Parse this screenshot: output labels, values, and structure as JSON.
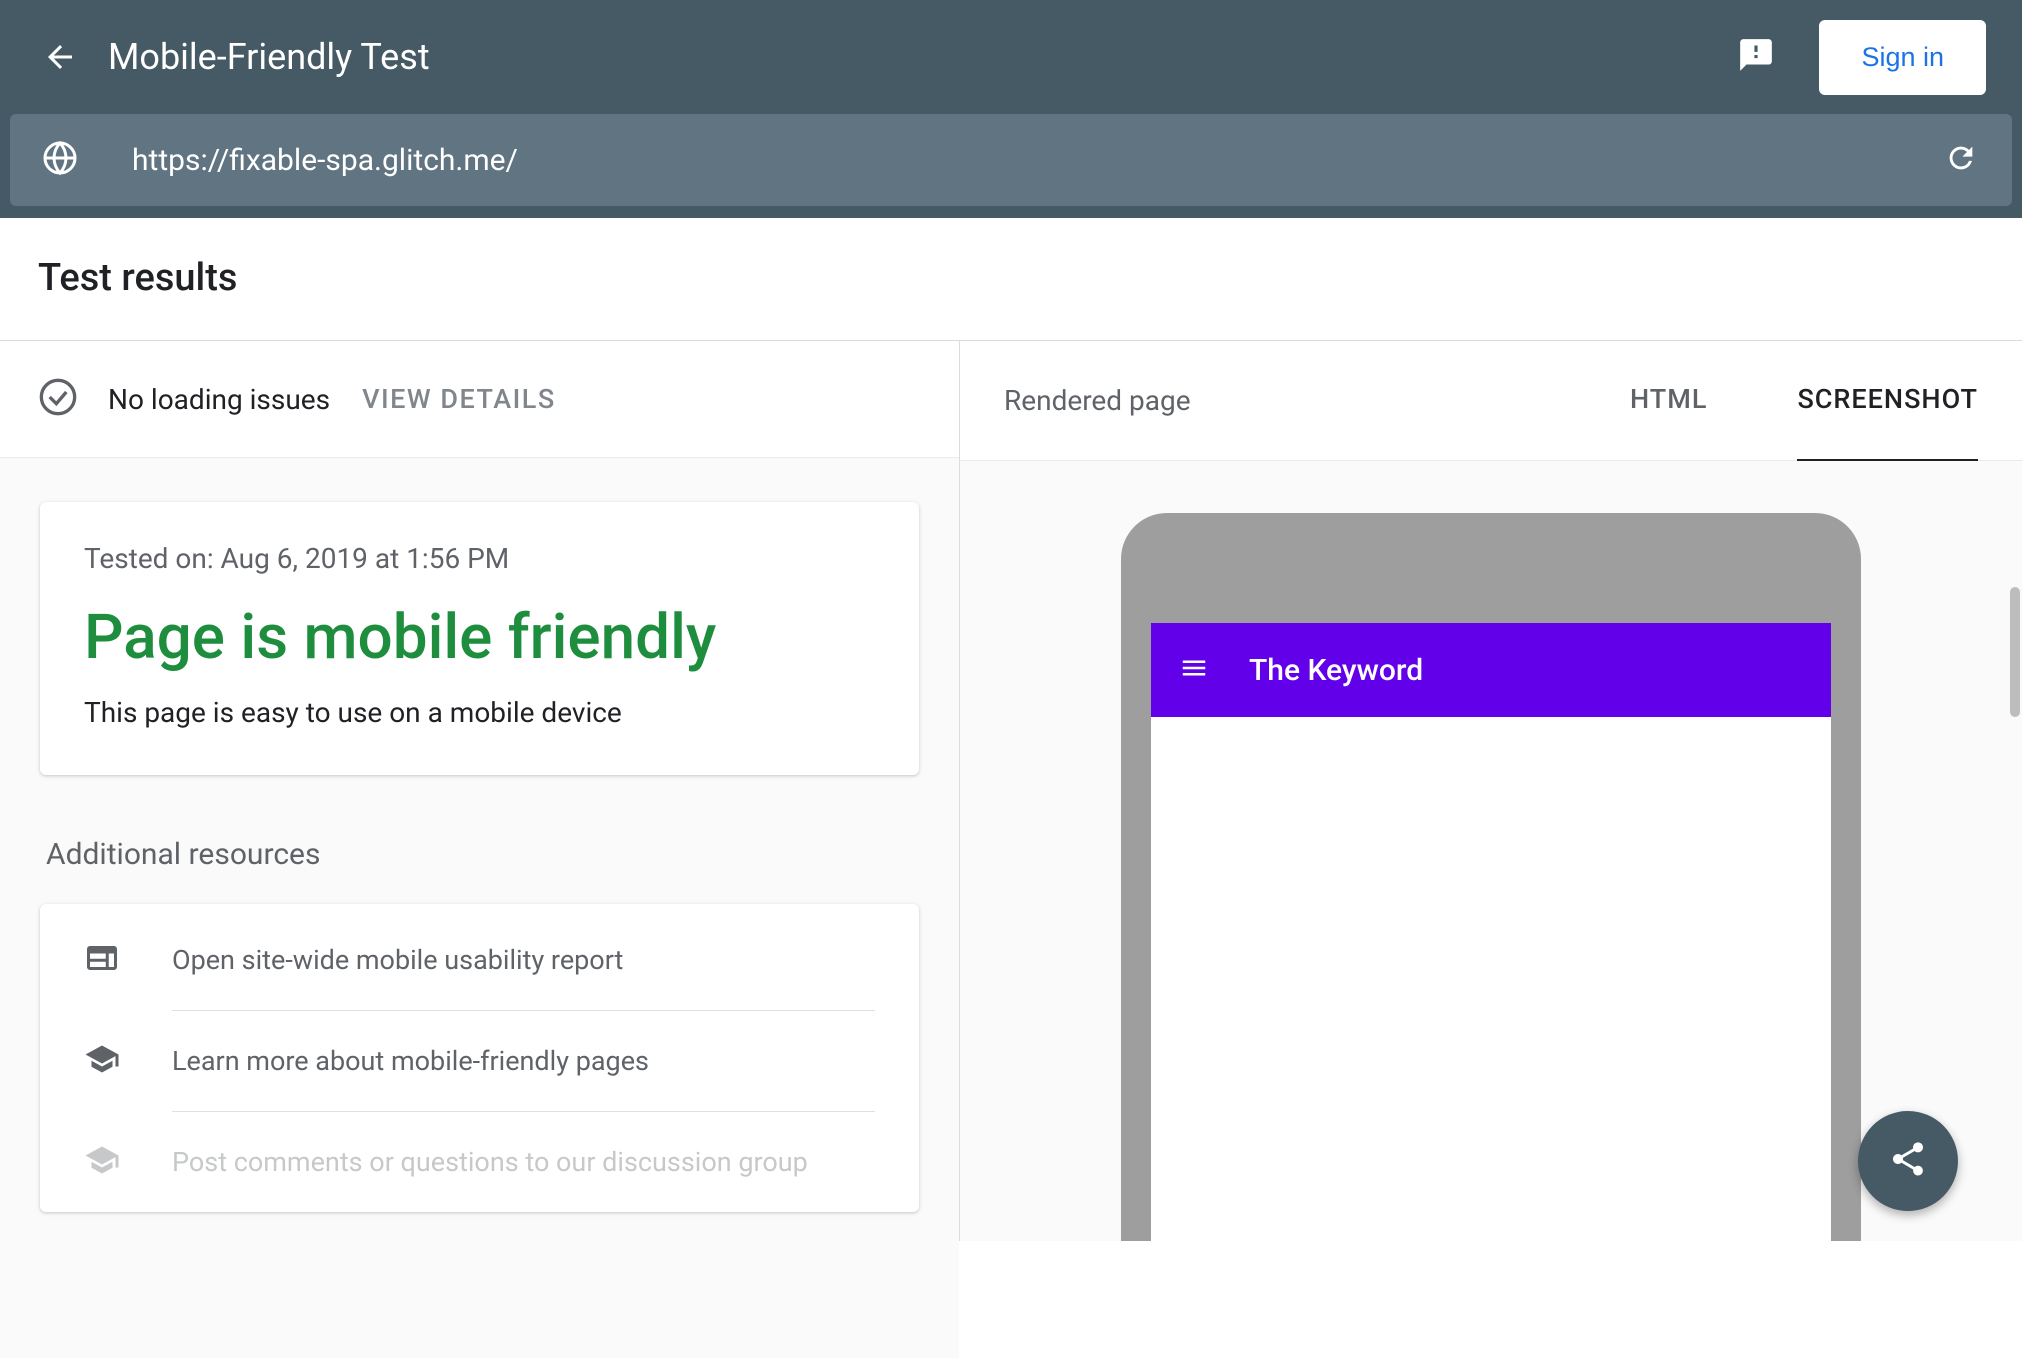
{
  "header": {
    "title": "Mobile-Friendly Test",
    "signin_label": "Sign in"
  },
  "urlbar": {
    "url": "https://fixable-spa.glitch.me/"
  },
  "results": {
    "heading": "Test results",
    "loading_status": "No loading issues",
    "view_details": "VIEW DETAILS",
    "tested_on": "Tested on: Aug 6, 2019 at 1:56 PM",
    "verdict": "Page is mobile friendly",
    "verdict_desc": "This page is easy to use on a mobile device"
  },
  "resources": {
    "title": "Additional resources",
    "items": [
      {
        "label": "Open site-wide mobile usability report"
      },
      {
        "label": "Learn more about mobile-friendly pages"
      },
      {
        "label": "Post comments or questions to our discussion group"
      }
    ]
  },
  "right": {
    "rendered_label": "Rendered page",
    "tabs": {
      "html": "HTML",
      "screenshot": "SCREENSHOT"
    },
    "phone_title": "The Keyword"
  }
}
